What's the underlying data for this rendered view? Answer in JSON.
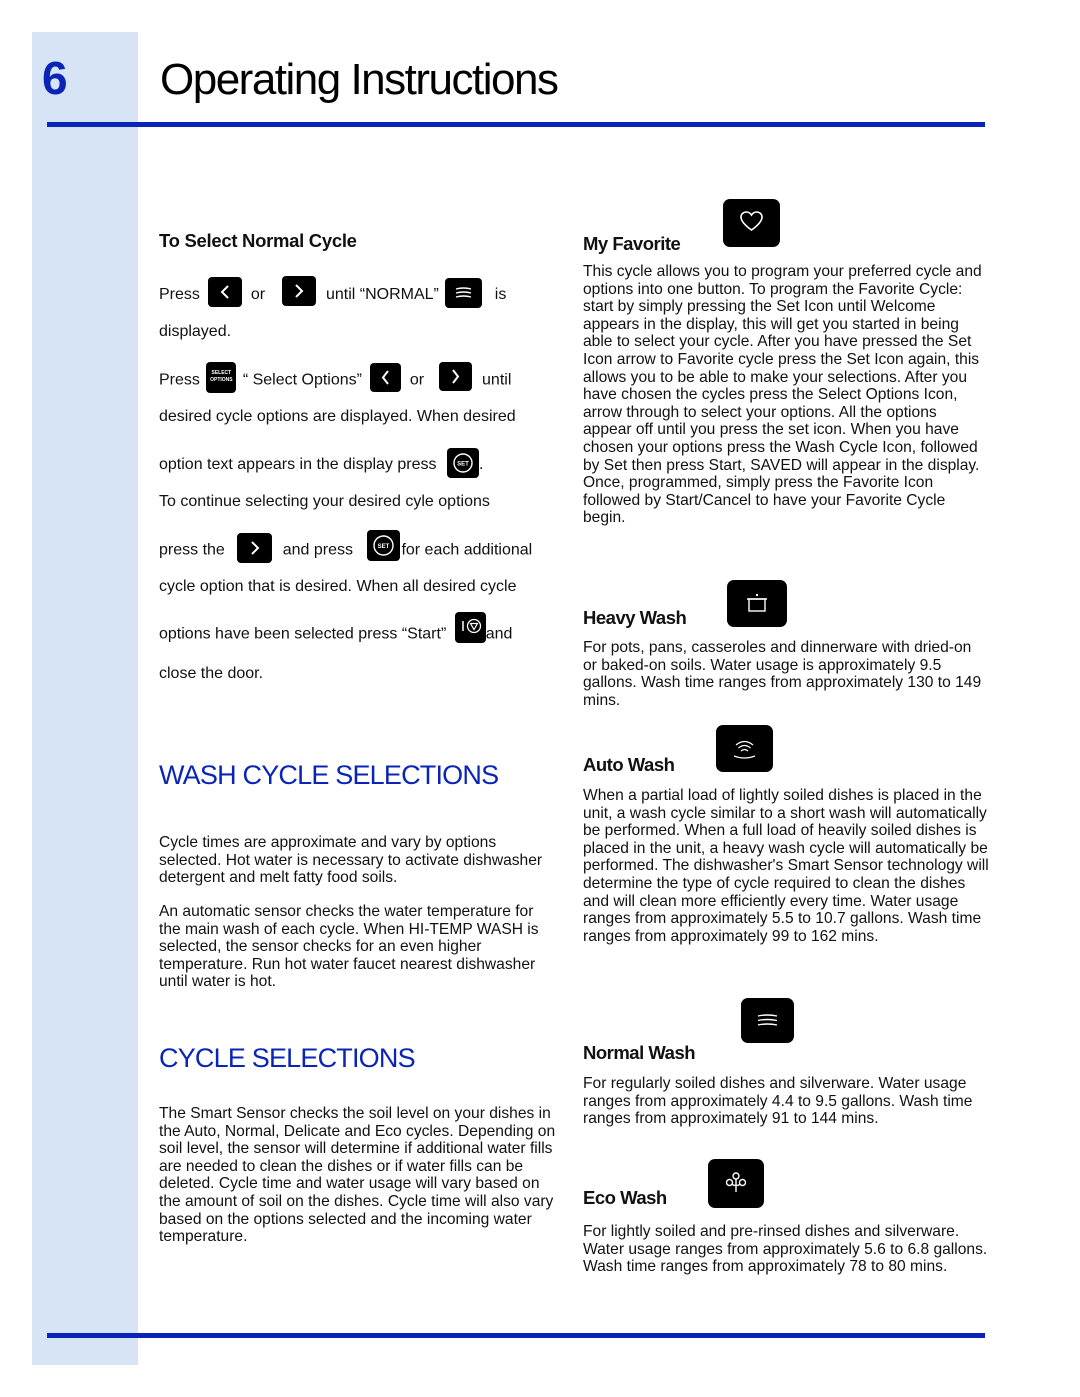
{
  "header": {
    "chapter_number": "6",
    "title": "Operating Instructions"
  },
  "select_normal": {
    "heading": "To Select Normal Cycle",
    "line1": {
      "a": "Press",
      "b": "or",
      "c": "until “NORMAL”",
      "d": "is"
    },
    "line2": "displayed.",
    "line3": {
      "a": "Press",
      "b": "“ Select Options”",
      "c": "or",
      "d": "until"
    },
    "line4": "desired cycle options are displayed.  When desired",
    "line5": {
      "a": "option text appears in the display press",
      "b": "."
    },
    "line6": "To continue selecting your desired cyle options",
    "line7": {
      "a": "press the",
      "b": "and press",
      "c": "for each additional"
    },
    "line8": "cycle option that is desired.  When all desired cycle",
    "line9": {
      "a": "options have been selected press “Start”",
      "b": "and"
    },
    "line10": "close the door.",
    "buttons": {
      "left_arrow": "chevron-left-icon",
      "right_arrow": "chevron-right-icon",
      "normal": "normal-wash-icon",
      "select_options_line1": "SELECT",
      "select_options_line2": "OPTIONS",
      "set": "SET",
      "start": "start-icon"
    }
  },
  "wash_cycle_selections": {
    "title": "WASH CYCLE SELECTIONS",
    "para1": "Cycle times are approximate and vary by options selected. Hot water is necessary to activate dishwasher detergent and melt fatty food soils.",
    "para2": "An automatic sensor checks the water temperature for the main wash of each cycle. When HI-TEMP WASH is selected, the sensor checks for an even higher temperature.  Run hot water faucet nearest dishwasher until water is hot."
  },
  "cycle_selections": {
    "title": "CYCLE SELECTIONS",
    "para": "The Smart Sensor checks the soil level on your dishes in the Auto, Normal, Delicate and Eco cycles. Depending on soil level, the sensor will determine if additional water fills are needed to clean the dishes or if water fills can be deleted. Cycle time and water usage will vary based on the amount of soil on the dishes. Cycle time will also vary based on the options selected and the incoming water temperature."
  },
  "cycles": [
    {
      "name": "My Favorite",
      "icon": "heart-icon",
      "description": "This cycle allows you to program your preferred cycle and options into one button.  To program the Favorite Cycle:  start by simply pressing the Set Icon until Welcome appears in the display, this will get you started in being able to select your cycle. After you have pressed the Set Icon arrow to Favorite cycle press the Set Icon again, this allows you to be able to make your selections.  After you have chosen the cycles press the Select Options Icon, arrow through to select your options.  All the options appear off until you press the set icon. When you have chosen your options press the Wash Cycle Icon, followed by Set then press Start, SAVED will appear in the display.   Once, programmed, simply press the Favorite Icon followed by Start/Cancel to have your Favorite Cycle begin."
    },
    {
      "name": "Heavy Wash",
      "icon": "pot-icon",
      "description": "For pots, pans, casseroles and dinnerware with dried-on or baked-on soils. Water usage is approximately 9.5 gallons. Wash time ranges from approximately 130 to 149 mins."
    },
    {
      "name": "Auto Wash",
      "icon": "sensor-waves-icon",
      "description": "When a partial load of lightly soiled dishes is placed in the unit, a wash cycle similar to a short wash will automatically be performed. When a full load of heavily soiled dishes is placed in the unit, a heavy wash cycle will automatically be performed. The dishwasher's Smart Sensor technology will determine the type of cycle required to clean the dishes and will clean more efficiently every time. Water usage ranges from approximately 5.5 to 10.7 gallons. Wash time ranges from approximately 99 to 162 mins."
    },
    {
      "name": "Normal Wash",
      "icon": "stacked-plates-icon",
      "description": "For regularly soiled dishes and silverware. Water usage ranges from approximately  4.4 to 9.5 gallons. Wash time ranges from approximately 91 to 144 mins."
    },
    {
      "name": "Eco Wash",
      "icon": "eco-plant-icon",
      "description": "For lightly soiled and pre-rinsed dishes and silverware.  Water usage ranges from approximately 5.6 to 6.8 gallons.  Wash time ranges from approximately 78 to 80 mins."
    }
  ],
  "colors": {
    "accent_blue": "#0a24b8",
    "sidebar_blue": "#d6e4f5",
    "icon_background": "#000000"
  }
}
